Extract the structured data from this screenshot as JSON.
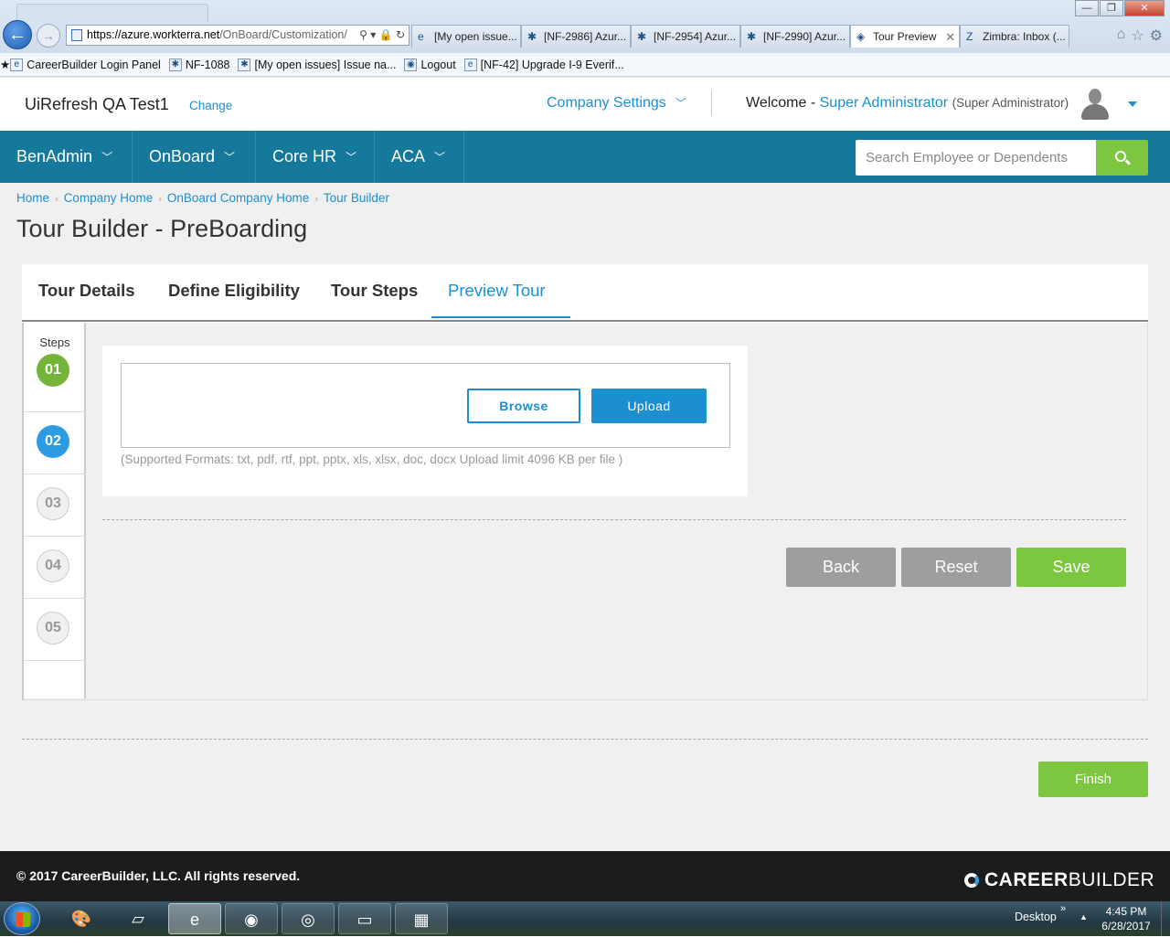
{
  "browser": {
    "url_domain": "https://azure.workterra.net",
    "url_path": "/OnBoard/Customization/",
    "tabs": [
      {
        "label": "[My open issue...",
        "icon": "ie-icon"
      },
      {
        "label": "[NF-2986] Azur...",
        "icon": "jira-icon"
      },
      {
        "label": "[NF-2954] Azur...",
        "icon": "jira-icon"
      },
      {
        "label": "[NF-2990] Azur...",
        "icon": "jira-icon"
      },
      {
        "label": "Tour Preview",
        "icon": "page-icon",
        "active": true
      },
      {
        "label": "Zimbra: Inbox (...",
        "icon": "zimbra-icon"
      }
    ],
    "favorites": [
      {
        "label": "CareerBuilder Login Panel"
      },
      {
        "label": "NF-1088"
      },
      {
        "label": "[My open issues] Issue na..."
      },
      {
        "label": "Logout"
      },
      {
        "label": "[NF-42] Upgrade I-9 Everif..."
      }
    ]
  },
  "header": {
    "company_name": "UiRefresh QA Test1",
    "change_label": "Change",
    "company_settings_label": "Company Settings",
    "welcome_label": "Welcome -",
    "user_name": "Super Administrator",
    "user_role": "(Super Administrator)"
  },
  "nav": {
    "items": [
      {
        "label": "BenAdmin"
      },
      {
        "label": "OnBoard"
      },
      {
        "label": "Core HR"
      },
      {
        "label": "ACA"
      }
    ],
    "search_placeholder": "Search Employee or Dependents"
  },
  "breadcrumb": [
    "Home",
    "Company Home",
    "OnBoard Company Home",
    "Tour Builder"
  ],
  "page_title": "Tour Builder - PreBoarding",
  "tabs": [
    {
      "label": "Tour Details"
    },
    {
      "label": "Define Eligibility"
    },
    {
      "label": "Tour Steps"
    },
    {
      "label": "Preview Tour",
      "active": true
    }
  ],
  "steps": {
    "label": "Steps",
    "items": [
      {
        "number": "01",
        "state": "done"
      },
      {
        "number": "02",
        "state": "current"
      },
      {
        "number": "03",
        "state": "todo"
      },
      {
        "number": "04",
        "state": "todo"
      },
      {
        "number": "05",
        "state": "todo"
      }
    ]
  },
  "upload": {
    "browse_label": "Browse",
    "upload_label": "Upload",
    "formats_note": "(Supported Formats: txt, pdf, rtf, ppt, pptx, xls, xlsx, doc, docx Upload limit 4096 KB per file )"
  },
  "actions": {
    "back_label": "Back",
    "reset_label": "Reset",
    "save_label": "Save",
    "finish_label": "Finish"
  },
  "footer": {
    "copyright": "© 2017 CareerBuilder, LLC. All rights reserved.",
    "logo_career": "CAREER",
    "logo_builder": "BUILDER"
  },
  "taskbar": {
    "desktop_label": "Desktop",
    "time": "4:45 PM",
    "date": "6/28/2017"
  },
  "colors": {
    "nav_bg": "#16799c",
    "accent_blue": "#1c8fd0",
    "accent_green": "#7dc63f",
    "grey_button": "#9e9e9e",
    "footer_bg": "#1c1c1c"
  }
}
